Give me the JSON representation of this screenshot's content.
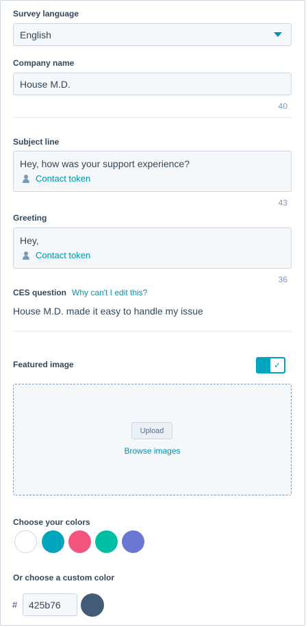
{
  "survey_language": {
    "label": "Survey language",
    "value": "English"
  },
  "company_name": {
    "label": "Company name",
    "value": "House M.D.",
    "counter": "40"
  },
  "subject_line": {
    "label": "Subject line",
    "text": "Hey, how was your support experience?",
    "token": "Contact token",
    "counter": "43"
  },
  "greeting": {
    "label": "Greeting",
    "text": "Hey,",
    "token": "Contact token",
    "counter": "36"
  },
  "ces_question": {
    "label": "CES question",
    "help_link": "Why can't I edit this?",
    "text": "House M.D. made it easy to handle my issue"
  },
  "featured_image": {
    "label": "Featured image",
    "toggle_on": true,
    "upload_label": "Upload",
    "browse_label": "Browse images"
  },
  "colors": {
    "label": "Choose your colors",
    "swatches": [
      "#ffffff",
      "#00a4bd",
      "#f2547d",
      "#00bda5",
      "#6a78d1"
    ],
    "custom_label": "Or choose a custom color",
    "hash": "#",
    "custom_value": "425b76",
    "custom_preview": "#425b76"
  }
}
